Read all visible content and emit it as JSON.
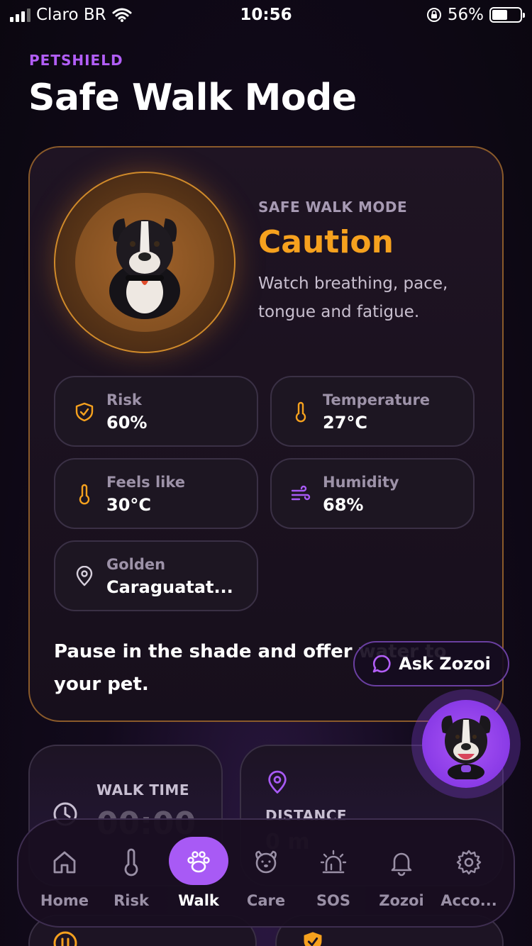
{
  "status_bar": {
    "carrier": "Claro BR",
    "time": "10:56",
    "battery": "56%",
    "battery_level": 0.56
  },
  "header": {
    "brand": "PETSHIELD",
    "title": "Safe Walk Mode"
  },
  "walk_card": {
    "mode_label": "SAFE WALK MODE",
    "status": "Caution",
    "description": "Watch breathing, pace, tongue and fatigue.",
    "stats": [
      {
        "label": "Risk",
        "value": "60%",
        "icon": "shield-check-icon"
      },
      {
        "label": "Temperature",
        "value": "27°C",
        "icon": "thermometer-icon"
      },
      {
        "label": "Feels like",
        "value": "30°C",
        "icon": "thermometer-icon"
      },
      {
        "label": "Humidity",
        "value": "68%",
        "icon": "wind-icon"
      },
      {
        "label": "Golden",
        "value": "Caraguatat...",
        "icon": "location-pin-icon"
      }
    ],
    "advice": "Pause in the shade and offer water to your pet."
  },
  "ask_button": {
    "label": "Ask Zozoi"
  },
  "walk_time": {
    "label": "WALK TIME",
    "value": "00:00"
  },
  "distance": {
    "label": "DISTANCE",
    "value": "0 m"
  },
  "tabs": [
    {
      "label": "Home",
      "icon": "home-icon"
    },
    {
      "label": "Risk",
      "icon": "thermometer-icon"
    },
    {
      "label": "Walk",
      "icon": "paw-icon"
    },
    {
      "label": "Care",
      "icon": "dog-face-icon"
    },
    {
      "label": "SOS",
      "icon": "siren-icon"
    },
    {
      "label": "Zozoi",
      "icon": "bell-icon"
    },
    {
      "label": "Acco...",
      "icon": "gear-icon"
    }
  ],
  "colors": {
    "accent_purple": "#a85af5",
    "caution_orange": "#f6a11e",
    "brand_purple": "#b25ef8"
  }
}
